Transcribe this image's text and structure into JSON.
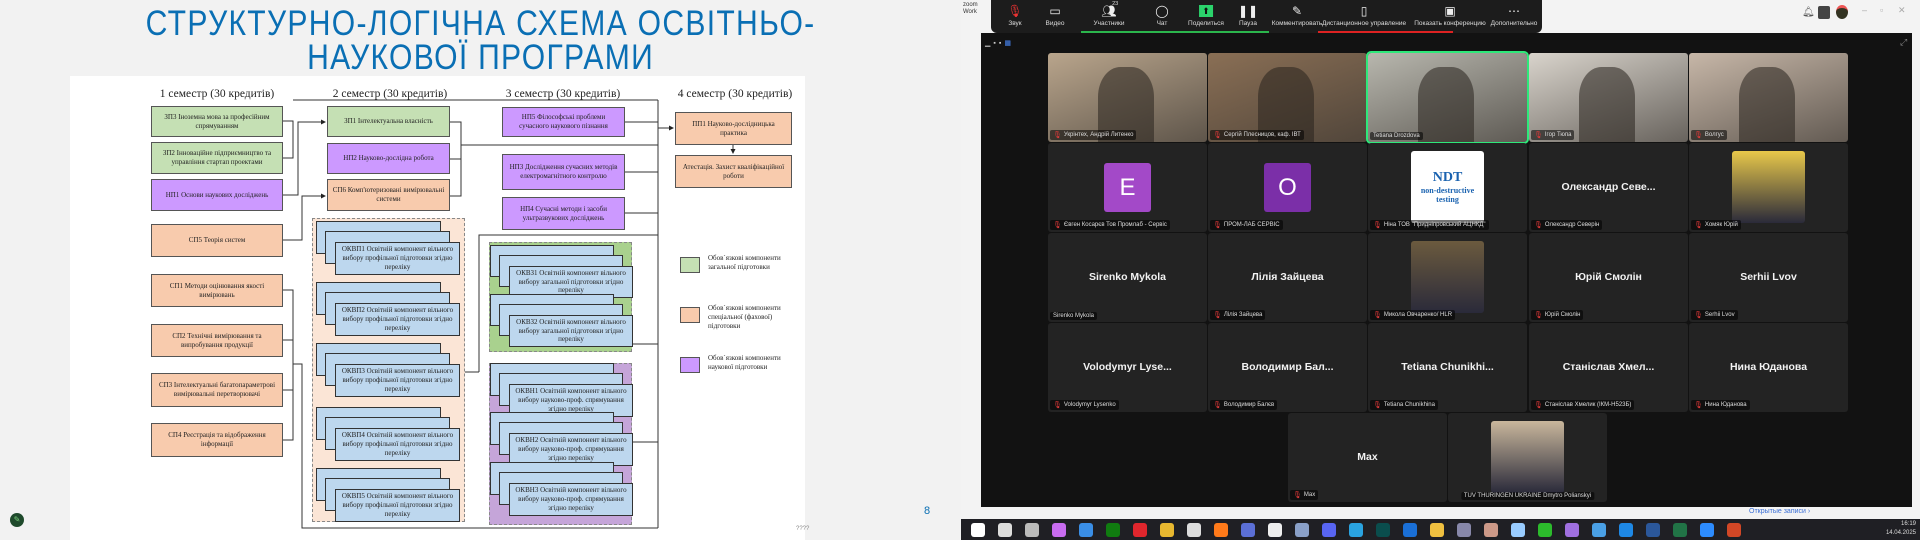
{
  "slide": {
    "title_line1": "СТРУКТУРНО-ЛОГІЧНА СХЕМА ОСВІТНЬО-",
    "title_line2": "НАУКОВОЇ ПРОГРАМИ",
    "semesters": [
      "1 семестр (30 кредитів)",
      "2 семестр (30 кредитів)",
      "3 семестр (30 кредитів)",
      "4 семестр (30 кредитів)"
    ],
    "sem1": [
      "ЗП3 Іноземна мова за професійним спрямуванням",
      "ЗП2 Інноваційне підприємництво та управління стартап проектами",
      "НП1 Основи наукових досліджень",
      "СП5 Теорія систем",
      "СП1 Методи оцінювання якості вимірювань",
      "СП2 Технічні вимірювання та випробування продукції",
      "СП3  Інтелектуальні багатопараметрові вимірювальні перетворювачі",
      "СП4 Реєстрація та відображення інформації"
    ],
    "sem2": [
      "ЗП1 Інтелектуальна власність",
      "НП2 Науково-дослідна робота",
      "СП6  Комп'ютеризовані вимірювальні системи"
    ],
    "okvp": [
      "ОКВП1 Освітній компонент вільного вибору профільної підготовки згідно переліку",
      "ОКВП2 Освітній компонент вільного вибору профільної підготовки згідно переліку",
      "ОКВП3 Освітній компонент вільного вибору профільної підготовки згідно переліку",
      "ОКВП4 Освітній компонент вільного вибору профільної підготовки згідно переліку",
      "ОКВП5 Освітній компонент вільного вибору профільної підготовки згідно переліку"
    ],
    "sem3": [
      "НП5 Філософські проблеми сучасного наукового пізнання",
      "НП3 Дослідження сучасних методів електромагнітного контролю",
      "НП4  Сучасні методи і засоби ультразвукових досліджень"
    ],
    "okvz": [
      "ОКВЗ1 Освітній компонент вільного вибору загальної підготовки згідно переліку",
      "ОКВЗ2 Освітній компонент вільного вибору загальної підготовки згідно переліку"
    ],
    "okvn": [
      "ОКВН1 Освітній компонент вільного вибору науково-проф. спрямування згідно переліку",
      "ОКВН2 Освітній компонент вільного вибору науково-проф. спрямування  згідно переліку",
      "ОКВН3 Освітній компонент вільного вибору науково-проф. спрямування згідно переліку"
    ],
    "sem4": [
      "ПП1 Науково-дослідницька практика",
      "Атестація. Захист кваліфікаційної роботи"
    ],
    "legend": [
      "Обов`язкові компоненти загальної підготовки",
      "Обов`язкові компоненти спеціальної (фахової) підготовки",
      "Обов`язкові компоненти наукової підготовки"
    ],
    "page_number": "8",
    "footer_mark": "????",
    "colors": {
      "general": "#c5e0b4",
      "special": "#f8cbad",
      "science": "#cc99ff",
      "elective": "#bdd7ee",
      "title": "#0a6fb4"
    }
  },
  "zoom": {
    "app_label": "zoom Work",
    "toolbar": [
      {
        "label": "Звук",
        "icon": "mic-muted-icon"
      },
      {
        "label": "Видео",
        "icon": "video-icon"
      },
      {
        "label": "Участники",
        "icon": "participants-icon",
        "count": "23"
      },
      {
        "label": "Чат",
        "icon": "chat-icon"
      },
      {
        "label": "Поделиться",
        "icon": "share-icon"
      },
      {
        "label": "Пауза",
        "icon": "pause-icon"
      },
      {
        "label": "Комментировать",
        "icon": "annotate-icon"
      },
      {
        "label": "Дистанционное управление",
        "icon": "remote-control-icon"
      },
      {
        "label": "Показать конференцию",
        "icon": "show-meeting-icon"
      },
      {
        "label": "Дополнительно",
        "icon": "more-icon"
      }
    ],
    "tiles": [
      {
        "type": "video",
        "label": "Укрінтех, Андрій Литенко",
        "muted": true,
        "color": "#b9a58c"
      },
      {
        "type": "video",
        "label": "Сергій Плесницов, каф. ІВТ",
        "muted": true,
        "color": "#8a6f55"
      },
      {
        "type": "video",
        "label": "Tetiana Drozdova",
        "muted": false,
        "color": "#b8b7ae",
        "active": true
      },
      {
        "type": "video",
        "label": "Ігор Тюпа",
        "muted": true,
        "color": "#d9d4cc"
      },
      {
        "type": "video",
        "label": "Волгус",
        "muted": true,
        "color": "#c7b7a8"
      },
      {
        "type": "avatar",
        "letter": "E",
        "color": "#a349c8",
        "label": "Євген Косарєв Тов Промлаб - Сервіс",
        "muted": true
      },
      {
        "type": "avatar",
        "letter": "O",
        "color": "#7b2fa8",
        "label": "ПРОМ-ЛАБ СЕРВІС",
        "muted": true
      },
      {
        "type": "ndt",
        "line1": "NDT",
        "line2": "non-destructive",
        "line3": "testing",
        "label": "Ніна ТОВ \"Придніпровський АЦНКД\"",
        "muted": true
      },
      {
        "type": "name",
        "name": "Олександр  Севе...",
        "label": "Олександр Северін",
        "muted": true
      },
      {
        "type": "photo",
        "color": "#e8c84a",
        "label": "Хомяк Юрій",
        "muted": true
      },
      {
        "type": "name",
        "name": "Sirenko Mykola",
        "label": "Sirenko Mykola",
        "muted": false
      },
      {
        "type": "name",
        "name": "Лілія Зайцева",
        "label": "Лілія Зайцева",
        "muted": true
      },
      {
        "type": "photo",
        "color": "#6b5a3e",
        "label": "Микола Овчаренко/ HLR",
        "muted": true
      },
      {
        "type": "name",
        "name": "Юрій Смолін",
        "label": "Юрій Смолін",
        "muted": true
      },
      {
        "type": "name",
        "name": "Serhii Lvov",
        "label": "Serhii Lvov",
        "muted": true
      },
      {
        "type": "name",
        "name": "Volodymyr  Lyse...",
        "label": "Volodymyr Lysenko",
        "muted": true
      },
      {
        "type": "name",
        "name": "Володимир  Бал...",
        "label": "Володимир Балєв",
        "muted": true
      },
      {
        "type": "name",
        "name": "Tetiana  Chunikhi...",
        "label": "Tetiana Chunikhina",
        "muted": true
      },
      {
        "type": "name",
        "name": "Станіслав  Хмел...",
        "label": "Станіслав Хмелик (ІКМ-Н523Б)",
        "muted": true
      },
      {
        "type": "name",
        "name": "Нина Юданова",
        "label": "Нина Юданова",
        "muted": true
      },
      {
        "type": "name",
        "name": "Max",
        "label": "Max",
        "muted": true
      },
      {
        "type": "photo",
        "color": "#c9b79c",
        "label": "TUV THURINGEN UKRAINE Dmytro Polianskyi",
        "muted": false,
        "center": true
      }
    ],
    "recordings_link": "Открытые записи  ›"
  },
  "taskbar": {
    "apps": [
      "start",
      "search",
      "task-view",
      "copilot",
      "store",
      "xbox",
      "opera",
      "chrome",
      "app-fox",
      "firefox",
      "save",
      "file",
      "settings",
      "discord",
      "telegram",
      "bg",
      "outlook",
      "explorer",
      "monitor",
      "paint",
      "notepad",
      "aida64",
      "games",
      "remote",
      "wps",
      "word",
      "excel",
      "zoom",
      "powerpoint"
    ],
    "time": "16:19",
    "date": "14.04.2025"
  }
}
